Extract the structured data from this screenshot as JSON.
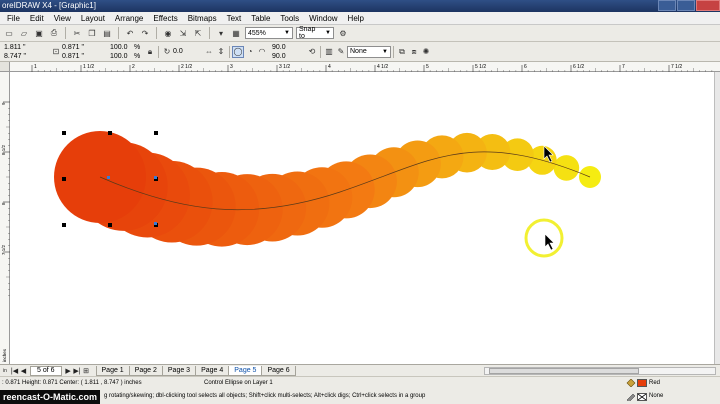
{
  "app": {
    "title": "oreIDRAW X4 - [Graphic1]"
  },
  "menu": [
    "File",
    "Edit",
    "View",
    "Layout",
    "Arrange",
    "Effects",
    "Bitmaps",
    "Text",
    "Table",
    "Tools",
    "Window",
    "Help"
  ],
  "toolbar": {
    "zoom": "455%",
    "snap_to": "Snap to",
    "outline": "None"
  },
  "propbar": {
    "x": "1.811 \"",
    "y": "8.747 \"",
    "w": "0.871 \"",
    "h": "0.871 \"",
    "scale_x": "100.0",
    "scale_y": "100.0",
    "pct": "%",
    "angle": "0.0",
    "start_angle": "90.0",
    "end_angle": "90.0",
    "outline_width": "None"
  },
  "ruler": {
    "top_ticks": [
      "1",
      "1 1/2",
      "2",
      "2 1/2",
      "3",
      "3 1/2",
      "4",
      "4 1/2",
      "5",
      "5 1/2",
      "6",
      "6 1/2",
      "7",
      "7 1/2"
    ],
    "left_ticks": [
      "9",
      "8 1/2",
      "8",
      "7 1/2"
    ],
    "units": "inches"
  },
  "pages": {
    "count": "5 of 6",
    "tabs": [
      "Page 1",
      "Page 2",
      "Page 3",
      "Page 4",
      "Page 5",
      "Page 6"
    ],
    "active": "Page 5"
  },
  "status": {
    "dimensions": ": 0.871  Height: 0.871  Center: ( 1.811 , 8.747 )  inches",
    "object": "Control Ellipse on Layer 1",
    "hint": "g rotating/skewing; dbl-clicking tool selects all objects; Shift+click multi-selects; Alt+click digs; Ctrl+click selects in a group",
    "fill_label": "Red",
    "outline_label": "None",
    "watermark": "reencast-O-Matic.com"
  },
  "colors": {
    "blend_start": "#e63e0a",
    "blend_mid": "#f37a12",
    "blend_end": "#f5ec12",
    "fill_swatch": "#e63e0a",
    "cursor_ring": "#f2f032"
  }
}
